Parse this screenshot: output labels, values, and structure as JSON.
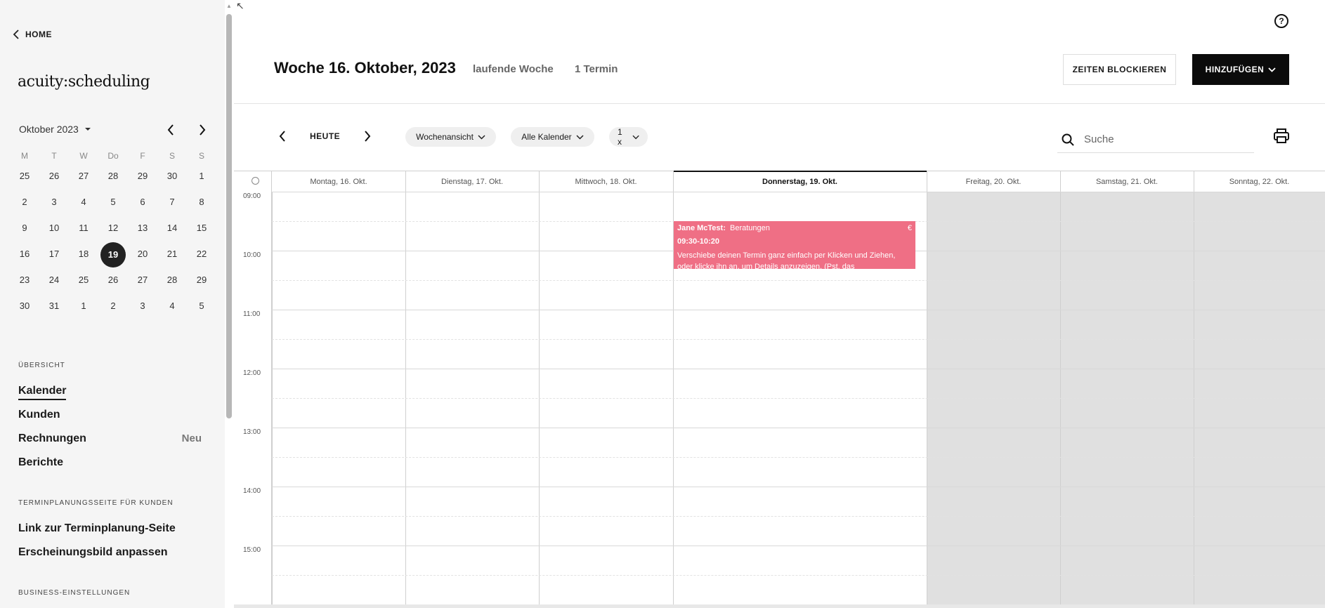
{
  "sidebar": {
    "home_label": "HOME",
    "logo_text": "acuity:scheduling",
    "mini_calendar": {
      "month_label": "Oktober 2023",
      "weekdays": [
        "M",
        "T",
        "W",
        "Do",
        "F",
        "S",
        "S"
      ],
      "weeks": [
        [
          "25",
          "26",
          "27",
          "28",
          "29",
          "30",
          "1"
        ],
        [
          "2",
          "3",
          "4",
          "5",
          "6",
          "7",
          "8"
        ],
        [
          "9",
          "10",
          "11",
          "12",
          "13",
          "14",
          "15"
        ],
        [
          "16",
          "17",
          "18",
          "19",
          "20",
          "21",
          "22"
        ],
        [
          "23",
          "24",
          "25",
          "26",
          "27",
          "28",
          "29"
        ],
        [
          "30",
          "31",
          "1",
          "2",
          "3",
          "4",
          "5"
        ]
      ],
      "today": "19"
    },
    "section_overview": "ÜBERSICHT",
    "nav": {
      "kalender": "Kalender",
      "kunden": "Kunden",
      "rechnungen": "Rechnungen",
      "rechnungen_badge": "Neu",
      "berichte": "Berichte"
    },
    "section_booking": "TERMINPLANUNGSSEITE FÜR KUNDEN",
    "booking": {
      "link": "Link zur Terminplanung-Seite",
      "appearance": "Erscheinungsbild anpassen"
    },
    "section_business": "BUSINESS-EINSTELLUNGEN"
  },
  "header": {
    "title": "Woche 16. Oktober, 2023",
    "current_week": "laufende Woche",
    "appointment_count": "1 Termin",
    "block_times_label": "ZEITEN BLOCKIEREN",
    "add_label": "HINZUFÜGEN",
    "help_icon": "question-circle-icon"
  },
  "toolbar": {
    "today_label": "HEUTE",
    "view_label": "Wochenansicht",
    "calendars_label": "Alle Kalender",
    "zoom_label": "1 x",
    "search_placeholder": "Suche"
  },
  "calendar": {
    "days": [
      "Montag, 16. Okt.",
      "Dienstag, 17. Okt.",
      "Mittwoch, 18. Okt.",
      "Donnerstag, 19. Okt.",
      "Freitag, 20. Okt.",
      "Samstag, 21. Okt.",
      "Sonntag, 22. Okt."
    ],
    "hours": [
      "09:00",
      "10:00",
      "11:00",
      "12:00",
      "13:00",
      "14:00",
      "15:00"
    ],
    "event": {
      "client": "Jane McTest:",
      "type": "Beratungen",
      "currency": "€",
      "time": "09:30-10:20",
      "description": "Verschiebe deinen Termin ganz einfach per Klicken und Ziehen, oder klicke ihn an, um Details anzuzeigen. (Pst, das"
    },
    "colors": {
      "event": "#ef6f85",
      "weekend": "#e0e0e0"
    }
  }
}
